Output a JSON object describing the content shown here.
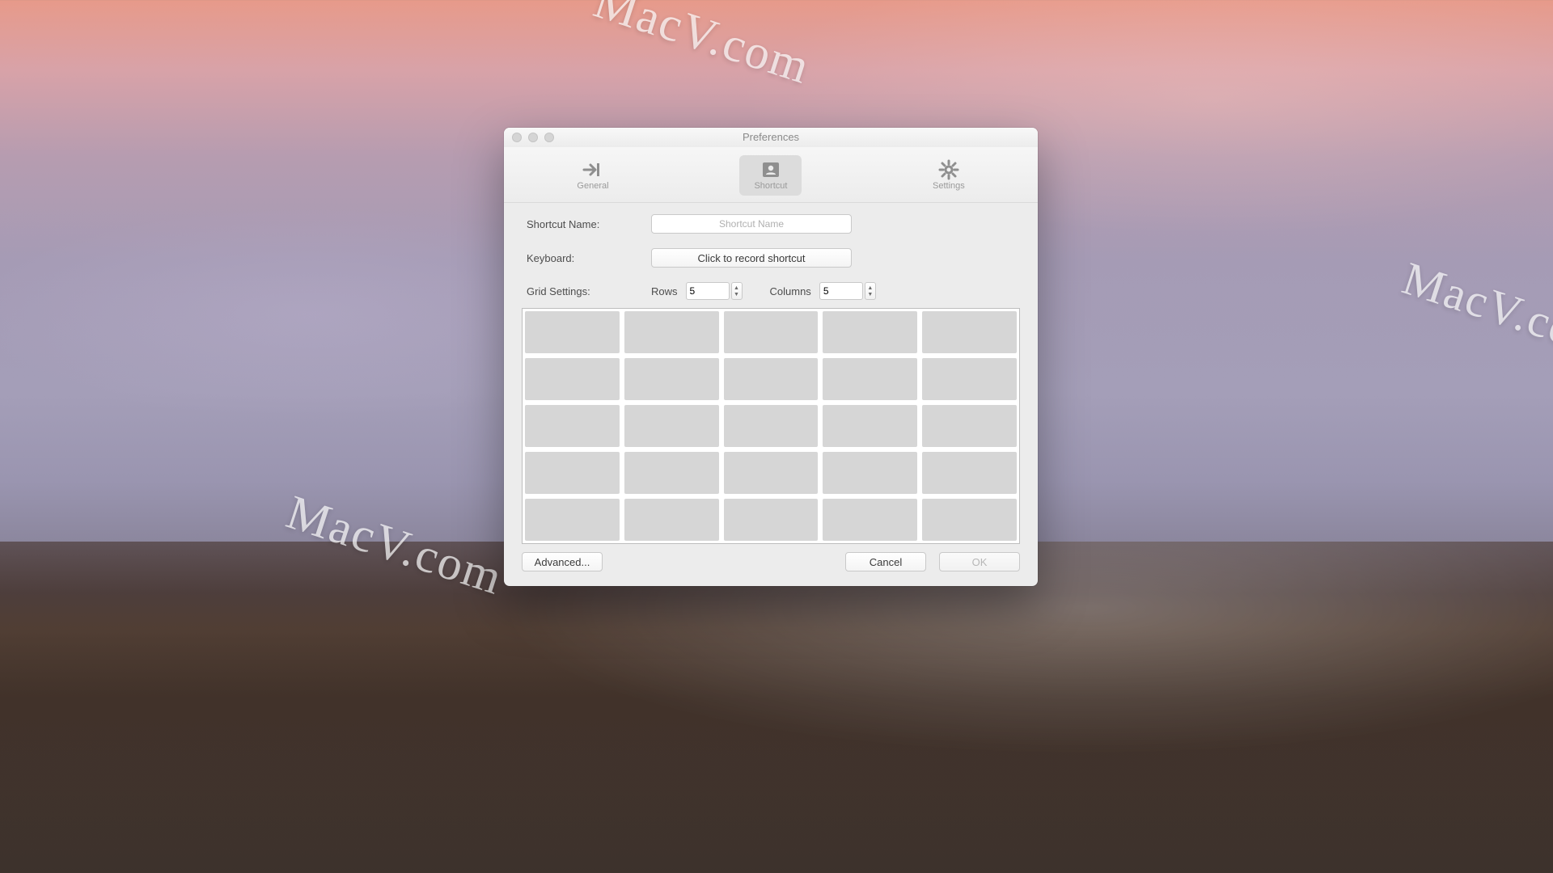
{
  "watermark_text": "MacV.com",
  "window": {
    "title": "Preferences",
    "toolbar": {
      "general": "General",
      "shortcut": "Shortcut",
      "settings": "Settings",
      "selected": "shortcut"
    }
  },
  "form": {
    "shortcut_name_label": "Shortcut Name:",
    "shortcut_name_placeholder": "Shortcut Name",
    "shortcut_name_value": "",
    "keyboard_label": "Keyboard:",
    "record_button": "Click to record shortcut",
    "grid_settings_label": "Grid Settings:",
    "rows_label": "Rows",
    "rows_value": "5",
    "columns_label": "Columns",
    "columns_value": "5"
  },
  "grid": {
    "rows": 5,
    "cols": 5
  },
  "buttons": {
    "advanced": "Advanced...",
    "cancel": "Cancel",
    "ok": "OK"
  }
}
